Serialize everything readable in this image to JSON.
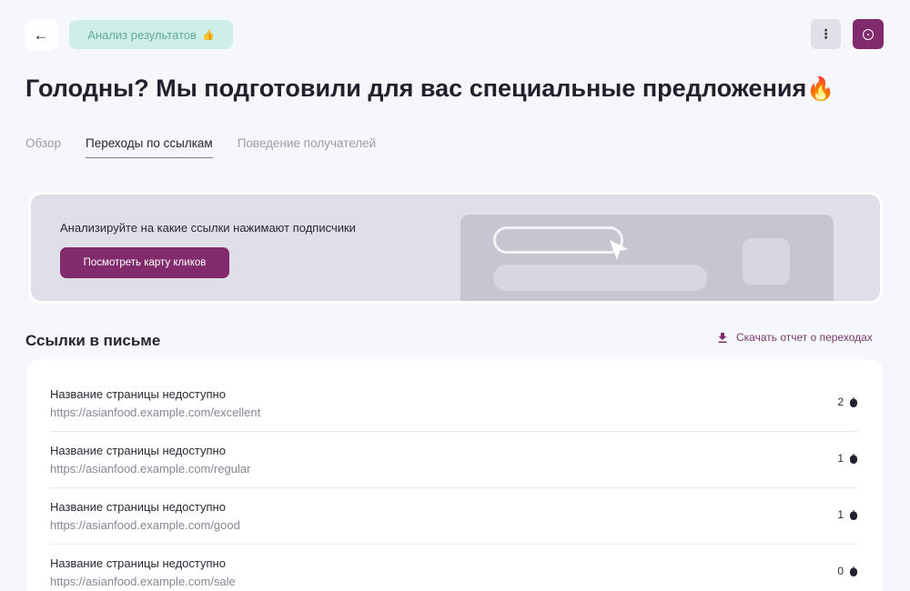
{
  "header": {
    "back_icon": "arrow-left-icon",
    "badge_label": "Анализ результатов",
    "badge_icon": "thumbs-up-icon",
    "more_icon": "more-vertical-icon",
    "info_icon": "info-circle-icon",
    "accent_color": "#822b6c"
  },
  "page": {
    "title": "Голодны? Мы подготовили для вас специальные предложения",
    "title_emoji": "🔥"
  },
  "tabs": [
    {
      "label": "Обзор",
      "active": false
    },
    {
      "label": "Переходы по ссылкам",
      "active": true
    },
    {
      "label": "Поведение получателей",
      "active": false
    }
  ],
  "promo": {
    "text": "Анализируйте на какие ссылки нажимают подписчики",
    "button_label": "Посмотреть карту кликов"
  },
  "links_section": {
    "title": "Ссылки в письме",
    "download_label": "Скачать отчет о переходах",
    "download_icon": "download-icon",
    "rows": [
      {
        "title": "Название страницы недоступно",
        "url": "https://asianfood.example.com/excellent",
        "count": "2",
        "icon": "mouse-icon"
      },
      {
        "title": "Название страницы недоступно",
        "url": "https://asianfood.example.com/regular",
        "count": "1",
        "icon": "mouse-icon"
      },
      {
        "title": "Название страницы недоступно",
        "url": "https://asianfood.example.com/good",
        "count": "1",
        "icon": "mouse-icon"
      },
      {
        "title": "Название страницы недоступно",
        "url": "https://asianfood.example.com/sale",
        "count": "0",
        "icon": "mouse-icon"
      }
    ]
  }
}
